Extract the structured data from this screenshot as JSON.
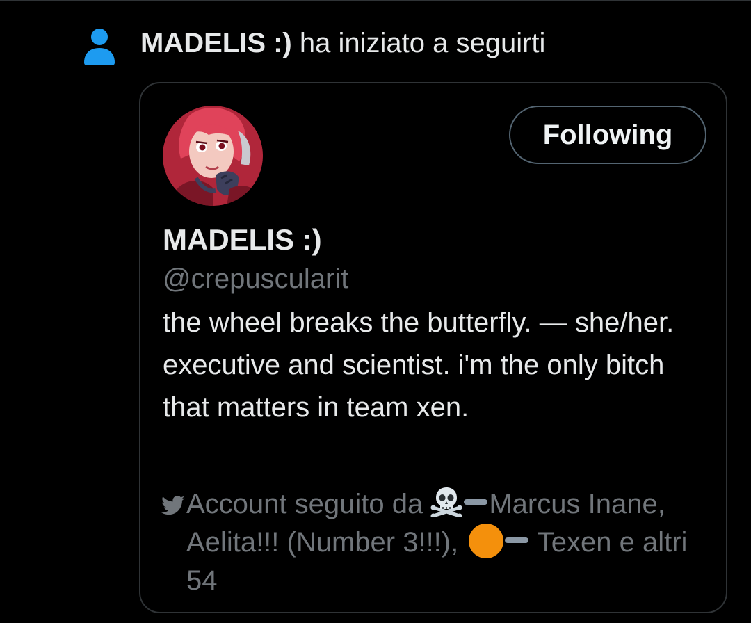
{
  "notification": {
    "icon": "person-icon",
    "icon_color": "#1d9bf0",
    "user_name": "MADELIS :)",
    "action_text": "ha iniziato a seguirti"
  },
  "profile_card": {
    "avatar": "profile-avatar",
    "follow_button_label": "Following",
    "display_name": "MADELIS :)",
    "handle": "@crepuscularit",
    "bio": "the wheel breaks the butterfly. — she/her. executive and scientist. i'm the only bitch that matters in team xen.",
    "followed_by": {
      "icon": "bird-icon",
      "prefix": "Account seguito da",
      "name1": "Marcus Inane",
      "separator": ", ",
      "name2": "Aelita!!! (Number 3!!!)",
      "name3": "Texen",
      "suffix": " e altri 54",
      "emoji_colors": {
        "orange_circle": "#f4900c",
        "dash": "#8b98a5"
      }
    }
  },
  "colors": {
    "background": "#000000",
    "text_primary": "#e7e9ea",
    "text_secondary": "#71767b",
    "border": "#2f3336",
    "accent": "#1d9bf0"
  }
}
